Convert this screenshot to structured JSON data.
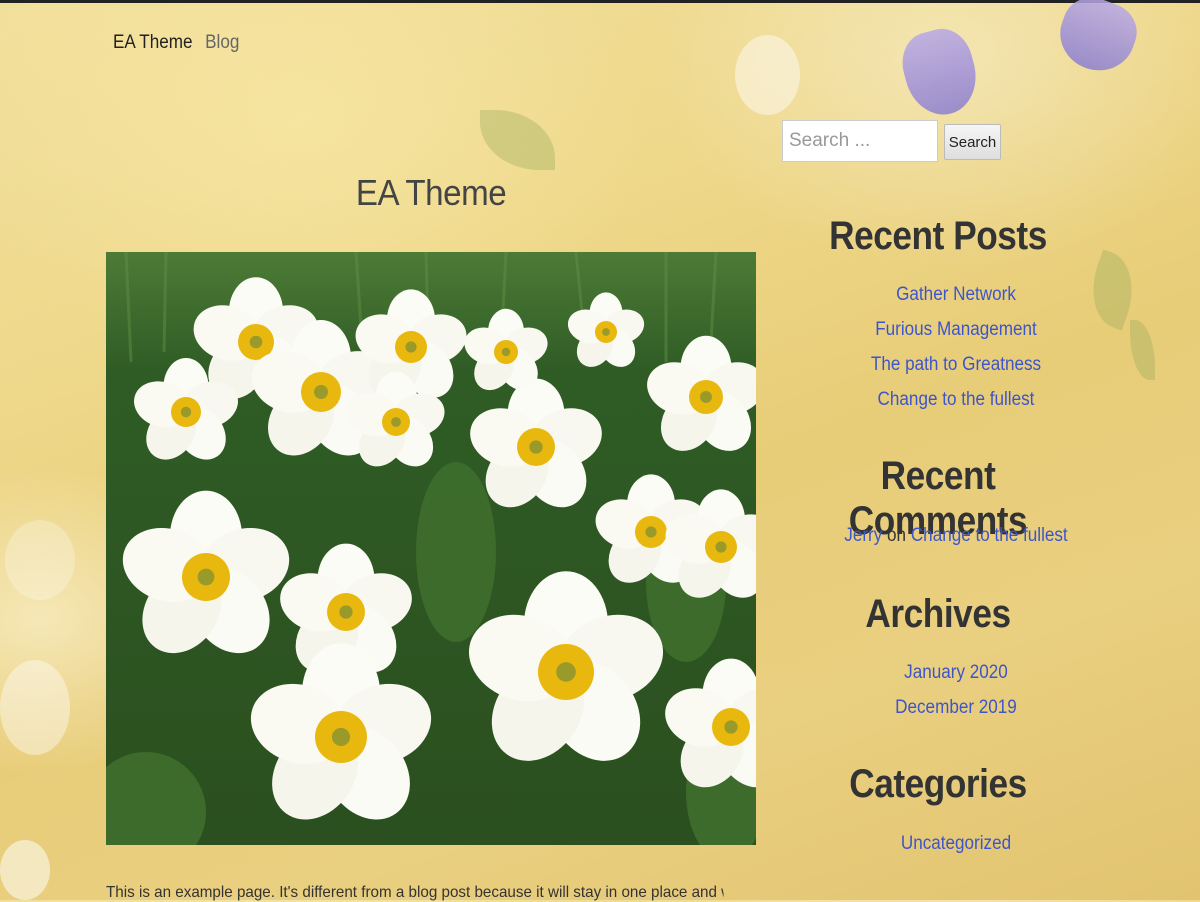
{
  "nav": {
    "brand": "EA Theme",
    "blog": "Blog"
  },
  "page": {
    "title": "EA Theme",
    "intro": "This is an example page. It's different from a blog post because it will stay in one place and will show"
  },
  "search": {
    "placeholder": "Search ...",
    "button": "Search"
  },
  "sidebar": {
    "recent_posts": {
      "title": "Recent Posts",
      "items": [
        "Gather Network",
        "Furious Management",
        "The path to Greatness",
        "Change to the fullest"
      ]
    },
    "recent_comments": {
      "title": "Recent Comments",
      "items": [
        {
          "author": "Jerry",
          "on": "on",
          "post": "Change to the fullest"
        }
      ]
    },
    "archives": {
      "title": "Archives",
      "items": [
        "January 2020",
        "December 2019"
      ]
    },
    "categories": {
      "title": "Categories",
      "items": [
        "Uncategorized"
      ]
    }
  },
  "colors": {
    "link": "#3d55c9",
    "heading": "#333333",
    "background": "#eed88a"
  }
}
